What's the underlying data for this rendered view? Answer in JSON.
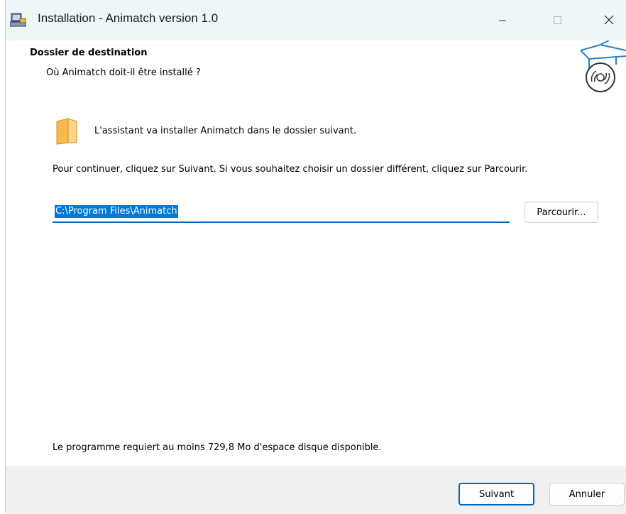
{
  "window": {
    "title": "Installation - Animatch version 1.0",
    "icons": [
      "installer-icon",
      "minimize-icon",
      "maximize-icon",
      "close-icon"
    ]
  },
  "header": {
    "title": "Dossier de destination",
    "subtitle": "Où Animatch doit-il être installé ?",
    "image": "setup-box-disc-icon"
  },
  "body": {
    "info": "L'assistant va installer Animatch dans le dossier suivant.",
    "instruction": "Pour continuer, cliquez sur Suivant. Si vous souhaitez choisir un dossier différent, cliquez sur Parcourir.",
    "path_value": "C:\\Program Files\\Animatch",
    "browse_label": "Parcourir...",
    "space_required": "Le programme requiert au moins 729,8 Mo d'espace disque disponible."
  },
  "footer": {
    "next_label": "Suivant",
    "cancel_label": "Annuler"
  },
  "colors": {
    "titlebar": "#eef7f6",
    "accent": "#0067c0",
    "selection": "#0078d7",
    "folder": "#f6b94d"
  }
}
